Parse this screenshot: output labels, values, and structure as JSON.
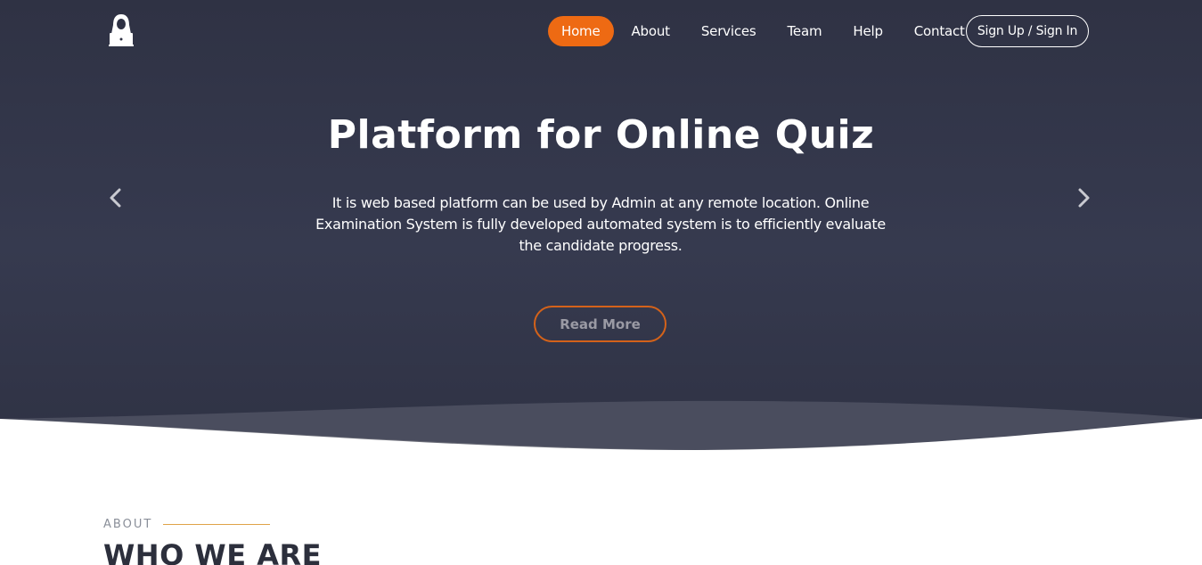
{
  "nav": {
    "items": [
      {
        "label": "Home",
        "active": true
      },
      {
        "label": "About",
        "active": false
      },
      {
        "label": "Services",
        "active": false
      },
      {
        "label": "Team",
        "active": false
      },
      {
        "label": "Help",
        "active": false
      },
      {
        "label": "Contact",
        "active": false
      }
    ],
    "signup_label": "Sign Up / Sign In",
    "logo_icon": "hooded-user-laptop-icon"
  },
  "hero": {
    "title": "Platform for Online Quiz",
    "text": "It is web based platform can be used by Admin at any remote location. Online Examination System is fully developed automated system is to efficiently evaluate the candidate progress.",
    "button_label": "Read More",
    "prev_icon": "chevron-left-icon",
    "next_icon": "chevron-right-icon"
  },
  "about": {
    "label": "ABOUT",
    "heading": "WHO WE ARE"
  },
  "colors": {
    "accent": "#ee6a13",
    "hero_bg": "#333647",
    "accent_line": "#e0a348"
  }
}
